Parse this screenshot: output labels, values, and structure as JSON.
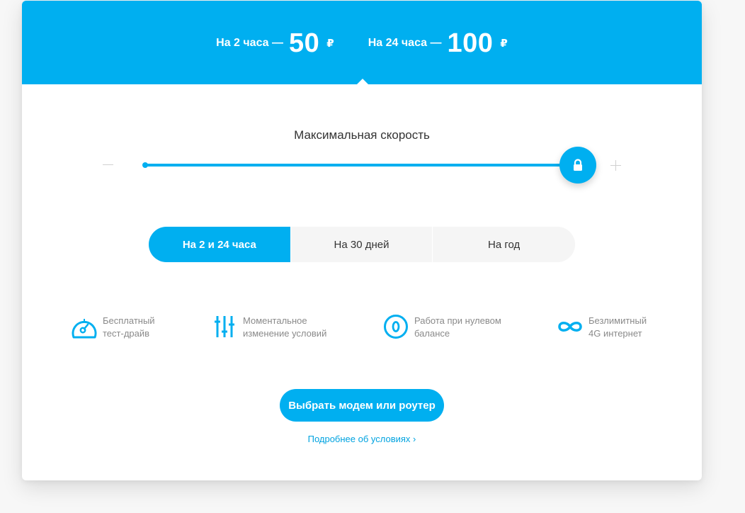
{
  "header": {
    "prices": [
      {
        "label": "На 2 часа —",
        "value": "50",
        "currency": "₽"
      },
      {
        "label": "На 24 часа —",
        "value": "100",
        "currency": "₽"
      }
    ]
  },
  "speed": {
    "title": "Максимальная скорость",
    "slider_value_fraction": 1.0,
    "thumb_icon": "lock-icon"
  },
  "tabs": [
    {
      "label": "На 2 и 24 часа",
      "active": true
    },
    {
      "label": "На 30 дней",
      "active": false
    },
    {
      "label": "На год",
      "active": false
    }
  ],
  "features": [
    {
      "icon": "speedometer-icon",
      "line1": "Бесплатный",
      "line2": "тест-драйв"
    },
    {
      "icon": "sliders-icon",
      "line1": "Моментальное",
      "line2": "изменение условий"
    },
    {
      "icon": "zero-balance-icon",
      "line1": "Работа при нулевом",
      "line2": "балансе"
    },
    {
      "icon": "infinity-icon",
      "line1": "Безлимитный",
      "line2": "4G интернет"
    }
  ],
  "cta": {
    "label": "Выбрать модем или роутер"
  },
  "more_link": {
    "label": "Подробнее об условиях ›"
  },
  "colors": {
    "accent": "#00aff0",
    "text": "#333333",
    "muted": "#8a8a8a"
  }
}
